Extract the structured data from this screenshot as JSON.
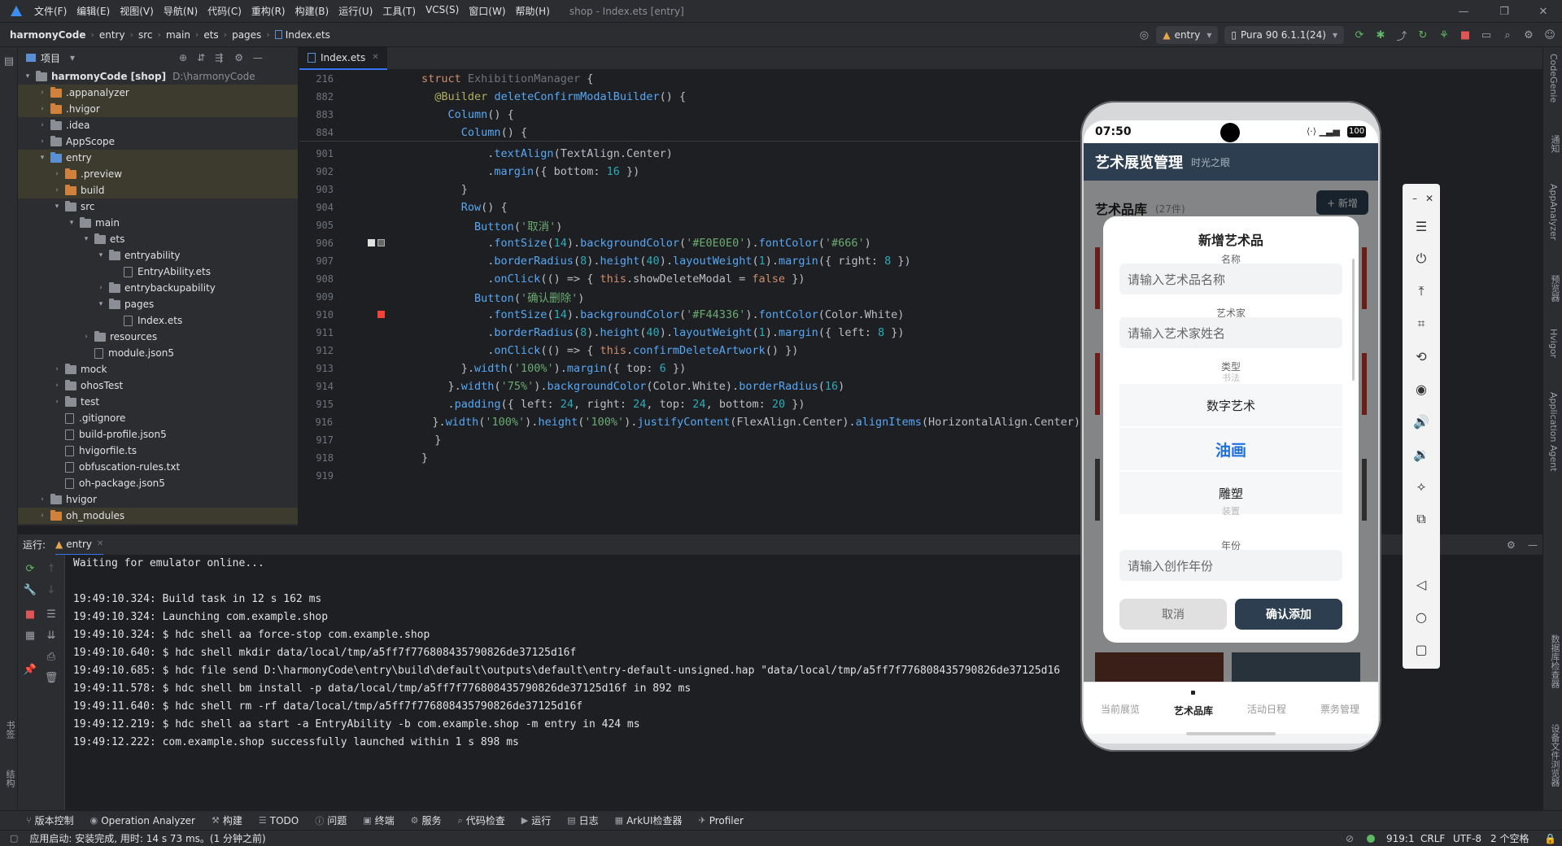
{
  "window": {
    "title": "shop - Index.ets [entry]",
    "menu": [
      "文件(F)",
      "编辑(E)",
      "视图(V)",
      "导航(N)",
      "代码(C)",
      "重构(R)",
      "构建(B)",
      "运行(U)",
      "工具(T)",
      "VCS(S)",
      "窗口(W)",
      "帮助(H)"
    ]
  },
  "breadcrumb": [
    "harmonyCode",
    "entry",
    "src",
    "main",
    "ets",
    "pages",
    "Index.ets"
  ],
  "toolbar": {
    "module": "entry",
    "device": "Pura 90 6.1.1(24)"
  },
  "project": {
    "header": "项目",
    "tree": [
      {
        "indent": 0,
        "arrow": "▾",
        "icon": "folder",
        "label": "harmonyCode [shop]",
        "dim": "D:\\harmonyCode",
        "hl": false
      },
      {
        "indent": 1,
        "arrow": "›",
        "icon": "folder-orange",
        "label": ".appanalyzer",
        "hl": true
      },
      {
        "indent": 1,
        "arrow": "›",
        "icon": "folder-orange",
        "label": ".hvigor",
        "hl": true
      },
      {
        "indent": 1,
        "arrow": "›",
        "icon": "folder",
        "label": ".idea",
        "hl": false
      },
      {
        "indent": 1,
        "arrow": "›",
        "icon": "folder",
        "label": "AppScope",
        "hl": false
      },
      {
        "indent": 1,
        "arrow": "▾",
        "icon": "folder-blue",
        "label": "entry",
        "hl": true
      },
      {
        "indent": 2,
        "arrow": "›",
        "icon": "folder-orange",
        "label": ".preview",
        "hl": true
      },
      {
        "indent": 2,
        "arrow": "›",
        "icon": "folder-orange",
        "label": "build",
        "hl": true
      },
      {
        "indent": 2,
        "arrow": "▾",
        "icon": "folder",
        "label": "src",
        "hl": false
      },
      {
        "indent": 3,
        "arrow": "▾",
        "icon": "folder",
        "label": "main",
        "hl": false
      },
      {
        "indent": 4,
        "arrow": "▾",
        "icon": "folder",
        "label": "ets",
        "hl": false
      },
      {
        "indent": 5,
        "arrow": "▾",
        "icon": "folder",
        "label": "entryability",
        "hl": false
      },
      {
        "indent": 6,
        "arrow": "",
        "icon": "file",
        "label": "EntryAbility.ets",
        "hl": false
      },
      {
        "indent": 5,
        "arrow": "›",
        "icon": "folder",
        "label": "entrybackupability",
        "hl": false
      },
      {
        "indent": 5,
        "arrow": "▾",
        "icon": "folder",
        "label": "pages",
        "hl": false
      },
      {
        "indent": 6,
        "arrow": "",
        "icon": "file",
        "label": "Index.ets",
        "hl": false
      },
      {
        "indent": 4,
        "arrow": "›",
        "icon": "folder",
        "label": "resources",
        "hl": false
      },
      {
        "indent": 4,
        "arrow": "",
        "icon": "file",
        "label": "module.json5",
        "hl": false
      },
      {
        "indent": 2,
        "arrow": "›",
        "icon": "folder",
        "label": "mock",
        "hl": false
      },
      {
        "indent": 2,
        "arrow": "›",
        "icon": "folder",
        "label": "ohosTest",
        "hl": false
      },
      {
        "indent": 2,
        "arrow": "›",
        "icon": "folder",
        "label": "test",
        "hl": false
      },
      {
        "indent": 2,
        "arrow": "",
        "icon": "file",
        "label": ".gitignore",
        "hl": false
      },
      {
        "indent": 2,
        "arrow": "",
        "icon": "file",
        "label": "build-profile.json5",
        "hl": false
      },
      {
        "indent": 2,
        "arrow": "",
        "icon": "file",
        "label": "hvigorfile.ts",
        "hl": false
      },
      {
        "indent": 2,
        "arrow": "",
        "icon": "file",
        "label": "obfuscation-rules.txt",
        "hl": false
      },
      {
        "indent": 2,
        "arrow": "",
        "icon": "file",
        "label": "oh-package.json5",
        "hl": false
      },
      {
        "indent": 1,
        "arrow": "›",
        "icon": "folder",
        "label": "hvigor",
        "hl": false
      },
      {
        "indent": 1,
        "arrow": "›",
        "icon": "folder-orange",
        "label": "oh_modules",
        "hl": true
      }
    ]
  },
  "editor": {
    "tab": "Index.ets",
    "sticky": [
      {
        "ln": "216",
        "html": "<span class='kw'>struct</span> <span style='color:#6f737a'>ExhibitionManager</span> {"
      },
      {
        "ln": "882",
        "html": "  <span class='dec'>@Builder</span> <span class='fn'>deleteConfirmModalBuilder</span>() {"
      },
      {
        "ln": "883",
        "html": "    <span class='fn'>Column</span>() {"
      },
      {
        "ln": "884",
        "html": "      <span class='fn'>Column</span>() {"
      }
    ],
    "lines": [
      {
        "ln": "901",
        "html": "          .<span class='fn'>textAlign</span>(TextAlign.Center)"
      },
      {
        "ln": "902",
        "html": "          .<span class='fn'>margin</span>({ bottom: <span class='num'>16</span> })"
      },
      {
        "ln": "903",
        "html": "      }"
      },
      {
        "ln": "904",
        "html": "      <span class='fn'>Row</span>() {"
      },
      {
        "ln": "905",
        "html": "        <span class='fn'>Button</span>(<span class='str'>'取消'</span>)"
      },
      {
        "ln": "906",
        "html": "          .<span class='fn'>fontSize</span>(<span class='num'>14</span>).<span class='fn'>backgroundColor</span>(<span class='str'>'#E0E0E0'</span>).<span class='fn'>fontColor</span>(<span class='str'>'#666'</span>)"
      },
      {
        "ln": "907",
        "html": "          .<span class='fn'>borderRadius</span>(<span class='num'>8</span>).<span class='fn'>height</span>(<span class='num'>40</span>).<span class='fn'>layoutWeight</span>(<span class='num'>1</span>).<span class='fn'>margin</span>({ right: <span class='num'>8</span> })"
      },
      {
        "ln": "908",
        "html": "          .<span class='fn'>onClick</span>(() => { <span class='kw'>this</span>.showDeleteModal = <span class='kw'>false</span> })"
      },
      {
        "ln": "909",
        "html": "        <span class='fn'>Button</span>(<span class='str'>'确认删除'</span>)"
      },
      {
        "ln": "910",
        "html": "          .<span class='fn'>fontSize</span>(<span class='num'>14</span>).<span class='fn'>backgroundColor</span>(<span class='str'>'#F44336'</span>).<span class='fn'>fontColor</span>(Color.White)"
      },
      {
        "ln": "911",
        "html": "          .<span class='fn'>borderRadius</span>(<span class='num'>8</span>).<span class='fn'>height</span>(<span class='num'>40</span>).<span class='fn'>layoutWeight</span>(<span class='num'>1</span>).<span class='fn'>margin</span>({ left: <span class='num'>8</span> })"
      },
      {
        "ln": "912",
        "html": "          .<span class='fn'>onClick</span>(() => { <span class='kw'>this</span>.<span class='fn'>confirmDeleteArtwork</span>() })"
      },
      {
        "ln": "913",
        "html": "      }.<span class='fn'>width</span>(<span class='str'>'100%'</span>).<span class='fn'>margin</span>({ top: <span class='num'>6</span> })"
      },
      {
        "ln": "914",
        "html": "    }.<span class='fn'>width</span>(<span class='str'>'75%'</span>).<span class='fn'>backgroundColor</span>(Color.White).<span class='fn'>borderRadius</span>(<span class='num'>16</span>)"
      },
      {
        "ln": "915",
        "html": "    .<span class='fn'>padding</span>({ left: <span class='num'>24</span>, right: <span class='num'>24</span>, top: <span class='num'>24</span>, bottom: <span class='num'>20</span> })"
      },
      {
        "ln": "916",
        "html": "  }.<span class='fn'>width</span>(<span class='str'>'100%'</span>).<span class='fn'>height</span>(<span class='str'>'100%'</span>).<span class='fn'>justifyContent</span>(FlexAlign.Center).<span class='fn'>alignItems</span>(HorizontalAlign.Center)"
      },
      {
        "ln": "917",
        "html": "  }"
      },
      {
        "ln": "918",
        "html": "}"
      },
      {
        "ln": "919",
        "html": ""
      }
    ],
    "inspections": {
      "warnings": "1",
      "ok": "1"
    }
  },
  "run": {
    "label": "运行:",
    "tab": "entry",
    "lines": [
      "Waiting for emulator online...",
      "",
      "19:49:10.324: Build task in 12 s 162 ms",
      "19:49:10.324: Launching com.example.shop",
      "19:49:10.324: $ hdc shell aa force-stop com.example.shop",
      "19:49:10.640: $ hdc shell mkdir data/local/tmp/a5ff7f776808435790826de37125d16f",
      "19:49:10.685: $ hdc file send D:\\harmonyCode\\entry\\build\\default\\outputs\\default\\entry-default-unsigned.hap \"data/local/tmp/a5ff7f776808435790826de37125d16",
      "19:49:11.578: $ hdc shell bm install -p data/local/tmp/a5ff7f776808435790826de37125d16f in 892 ms",
      "19:49:11.640: $ hdc shell rm -rf data/local/tmp/a5ff7f776808435790826de37125d16f",
      "19:49:12.219: $ hdc shell aa start -a EntryAbility -b com.example.shop -m entry in 424 ms",
      "19:49:12.222: com.example.shop successfully launched within 1 s 898 ms"
    ]
  },
  "bottom_tabs": [
    {
      "icon": "⑂",
      "label": "版本控制"
    },
    {
      "icon": "◉",
      "label": "Operation Analyzer"
    },
    {
      "icon": "⚒",
      "label": "构建"
    },
    {
      "icon": "☰",
      "label": "TODO"
    },
    {
      "icon": "ⓘ",
      "label": "问题"
    },
    {
      "icon": "▣",
      "label": "终端"
    },
    {
      "icon": "⚙",
      "label": "服务"
    },
    {
      "icon": "⌕",
      "label": "代码检查"
    },
    {
      "icon": "▶",
      "label": "运行"
    },
    {
      "icon": "▤",
      "label": "日志"
    },
    {
      "icon": "▦",
      "label": "ArkUI检查器"
    },
    {
      "icon": "✈",
      "label": "Profiler"
    }
  ],
  "status": {
    "message": "应用启动: 安装完成, 用时: 14 s 73 ms。(1 分钟之前)",
    "position": "919:1",
    "line_sep": "CRLF",
    "encoding": "UTF-8",
    "indent": "2 个空格"
  },
  "right_strip": [
    "CodeGenie",
    "通知",
    "AppAnalyzer",
    "预览器",
    "Hvigor",
    "Application Agent",
    "数据库检查器",
    "设备文件浏览器"
  ],
  "left_strip": [
    "项目",
    "书签",
    "结构"
  ],
  "phone": {
    "time": "07:50",
    "battery": "100",
    "app_title": "艺术展览管理",
    "app_subtitle": "时光之眼",
    "section_title": "艺术品库",
    "section_count": "(27件)",
    "add_button": "+ 新增",
    "modal": {
      "title": "新增艺术品",
      "name_label": "名称",
      "name_placeholder": "请输入艺术品名称",
      "artist_label": "艺术家",
      "artist_placeholder": "请输入艺术家姓名",
      "type_label": "类型",
      "picker_prev": "书法",
      "picker_above": "数字艺术",
      "picker_selected": "油画",
      "picker_below": "雕塑",
      "picker_next": "装置",
      "year_label": "年份",
      "year_placeholder": "请输入创作年份",
      "cancel": "取消",
      "confirm": "确认添加"
    },
    "tabs": [
      "当前展览",
      "艺术品库",
      "活动日程",
      "票务管理"
    ]
  },
  "colors": {
    "app_header": "#2c3e50",
    "accent_blue": "#1e6fe0",
    "confirm_btn": "#2c3e50"
  }
}
